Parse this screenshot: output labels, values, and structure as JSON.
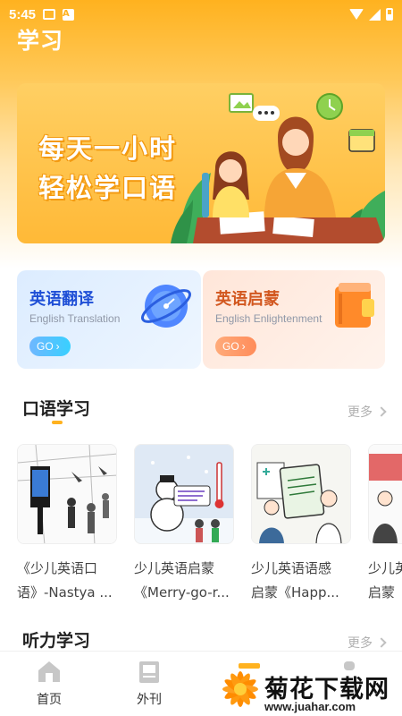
{
  "status_bar": {
    "time": "5:45",
    "icons": [
      "image-icon",
      "a-icon",
      "wifi-icon",
      "signal-icon",
      "battery-icon"
    ]
  },
  "page": {
    "title": "学习"
  },
  "banner": {
    "line1": "每天一小时",
    "line2": "轻松学口语"
  },
  "features": [
    {
      "title": "英语翻译",
      "subtitle": "English Translation",
      "button": "GO",
      "accent": "#1f4fd6"
    },
    {
      "title": "英语启蒙",
      "subtitle": "English Enlightenment",
      "button": "GO",
      "accent": "#d2571f"
    }
  ],
  "section_oral": {
    "title": "口语学习",
    "more": "更多",
    "courses": [
      {
        "line1": "《少儿英语口",
        "line2": "语》-Nastya ..."
      },
      {
        "line1": "少儿英语启蒙",
        "line2": "《Merry-go-r..."
      },
      {
        "line1": "少儿英语语感",
        "line2": "启蒙《Happ..."
      },
      {
        "line1": "少儿英",
        "line2": "启蒙"
      }
    ]
  },
  "section_listening": {
    "title": "听力学习",
    "more": "更多"
  },
  "tabbar": {
    "tabs": [
      {
        "label": "首页",
        "icon": "home-icon"
      },
      {
        "label": "外刊",
        "icon": "magazine-icon"
      },
      {
        "label": "",
        "icon": "learn-icon"
      },
      {
        "label": "",
        "icon": "profile-icon"
      }
    ]
  },
  "watermark": {
    "text": "菊花下载网",
    "url": "www.juahar.com"
  },
  "colors": {
    "brand": "#ffb21f",
    "translate_accent": "#1f4fd6",
    "enlight_accent": "#d2571f"
  }
}
